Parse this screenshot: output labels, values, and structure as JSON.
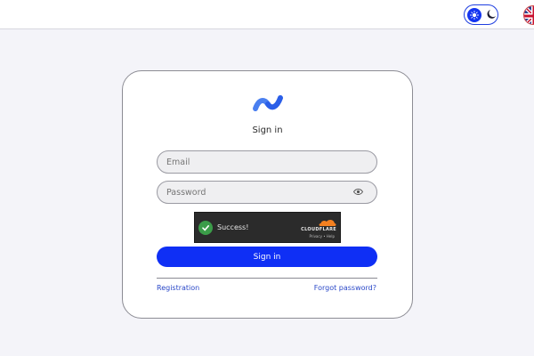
{
  "topbar": {
    "theme_toggle": {
      "state": "light",
      "icons": [
        "sun-icon",
        "moon-icon"
      ]
    },
    "language": {
      "icon": "uk-flag-icon"
    }
  },
  "login": {
    "logo_icon": "wave-logo-icon",
    "title": "Sign in",
    "email_placeholder": "Email",
    "password_placeholder": "Password",
    "password_toggle_icon": "eye-icon",
    "captcha": {
      "status": "Success!",
      "provider": "CLOUDFLARE",
      "privacy": "Privacy",
      "separator": "•",
      "help": "Help"
    },
    "submit_label": "Sign in",
    "registration_link": "Registration",
    "forgot_link": "Forgot password?"
  },
  "colors": {
    "accent": "#0f2ff5",
    "background": "#f4f4f9",
    "success": "#3b9c49",
    "link": "#2a48c8"
  }
}
